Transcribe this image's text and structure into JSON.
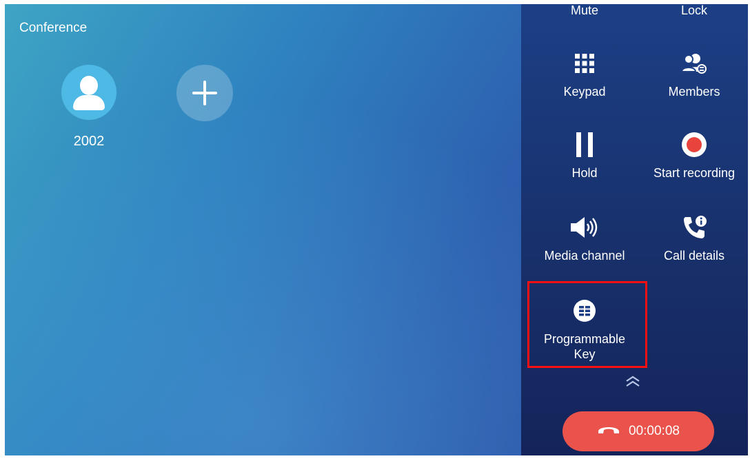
{
  "screen": {
    "title": "Conference"
  },
  "participants": [
    {
      "number": "2002",
      "icon": "user-avatar-icon"
    }
  ],
  "add_participant": {
    "icon": "plus-icon"
  },
  "actions": {
    "mute": "Mute",
    "lock": "Lock",
    "keypad": "Keypad",
    "members": "Members",
    "hold": "Hold",
    "start_recording": "Start recording",
    "media_channel": "Media channel",
    "call_details": "Call details",
    "programmable_key_line1": "Programmable",
    "programmable_key_line2": "Key"
  },
  "end_call": {
    "timer": "00:00:08",
    "icon": "hang-up-icon"
  },
  "colors": {
    "end_call": "#e9534c",
    "recording": "#e8433d",
    "avatar": "#4fb9e6",
    "highlight": "#ff1111"
  }
}
